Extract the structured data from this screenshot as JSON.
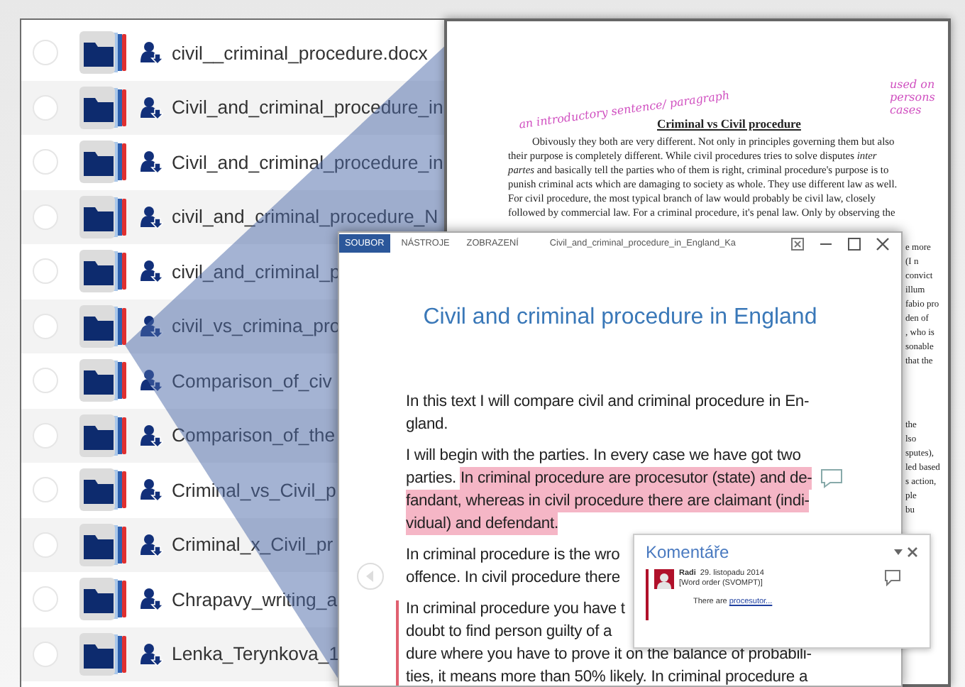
{
  "file_list": {
    "rows": [
      {
        "name": "civil__criminal_procedure.docx",
        "selected": false
      },
      {
        "name": "Civil_and_criminal_procedure_in",
        "selected": false
      },
      {
        "name": "Civil_and_criminal_procedure_in",
        "selected": false
      },
      {
        "name": "civil_and_criminal_procedure_N",
        "selected": false
      },
      {
        "name": "civil_and_criminal_p",
        "selected": false
      },
      {
        "name": "civil_vs_crimina_pro",
        "selected": false
      },
      {
        "name": "Comparison_of_civ",
        "selected": false
      },
      {
        "name": "Comparison_of_the",
        "selected": false
      },
      {
        "name": "Criminal_vs_Civil_p",
        "selected": false
      },
      {
        "name": "Criminal_x_Civil_pr",
        "selected": false
      },
      {
        "name": "Chrapavy_writing_a",
        "selected": false
      },
      {
        "name": "Lenka_Terynkova_1",
        "selected": false
      }
    ]
  },
  "back_document": {
    "annotations": [
      "an introductory sentence/ paragraph",
      "used on persons cases"
    ],
    "title": "Criminal vs Civil procedure",
    "lines": [
      "Obivously they both are very different. Not only in principles governing them but also",
      "their purpose is completely different. While civil procedures tries to solve disputes *inter*",
      "*partes* and basically tell the parties who of them is right, criminal procedure's purpose is to",
      "punish criminal acts which are damaging to society as whole. They use different law as well.",
      "For civil procedure, the most typical branch of law would probably be civil law, closely",
      "followed by commercial law. For a criminal procedure, it's penal law. Only by observing the"
    ],
    "side_fragments": [
      [
        "e more",
        "(I n",
        "convict",
        "illum",
        "fabio pro",
        "den of",
        ", who is",
        "sonable",
        "that the"
      ],
      [
        "the",
        "lso",
        "sputes),",
        "led based",
        "s action,",
        "ple",
        "bu"
      ]
    ]
  },
  "front_document": {
    "tabs": [
      {
        "label": "SOUBOR",
        "selected": true
      },
      {
        "label": "NÁSTROJE",
        "selected": false
      },
      {
        "label": "ZOBRAZENÍ",
        "selected": false
      }
    ],
    "file_title": "Civil_and_criminal_procedure_in_England_Ka",
    "heading": "Civil and criminal procedure in England",
    "paragraphs": [
      {
        "changed": false,
        "has_comment": false,
        "lines": [
          [
            {
              "text": "In this text I will compare civil and criminal procedure in En-",
              "highlighted": false
            }
          ],
          [
            {
              "text": "gland.",
              "highlighted": false
            }
          ]
        ]
      },
      {
        "changed": false,
        "has_comment": true,
        "lines": [
          [
            {
              "text": "I will begin with the parties. In every case we have got two",
              "highlighted": false
            }
          ],
          [
            {
              "text": "parties. ",
              "highlighted": false
            },
            {
              "text": "In criminal procedure are procesutor (state) and de-",
              "highlighted": true
            }
          ],
          [
            {
              "text": "fandant, whereas in civil procedure there are claimant (indi-",
              "highlighted": true
            }
          ],
          [
            {
              "text": "vidual) and defendant.",
              "highlighted": true
            }
          ]
        ]
      },
      {
        "changed": false,
        "has_comment": false,
        "lines": [
          [
            {
              "text": "In criminal procedure is the wro",
              "highlighted": false
            }
          ],
          [
            {
              "text": "offence. In civil procedure there",
              "highlighted": false
            }
          ]
        ]
      },
      {
        "changed": true,
        "has_comment": false,
        "lines": [
          [
            {
              "text": "In criminal procedure you have t",
              "highlighted": false
            }
          ],
          [
            {
              "text": "doubt to find person guilty of a",
              "highlighted": false
            }
          ],
          [
            {
              "text": "dure where you have to prove it on the balance of probabili-",
              "highlighted": false
            }
          ],
          [
            {
              "text": "ties, it means more than 50% likely. In criminal procedure a",
              "highlighted": false
            }
          ]
        ]
      }
    ]
  },
  "comments_pane": {
    "title": "Komentáře",
    "comments": [
      {
        "author": "Radi",
        "date": "29. listopadu 2014",
        "tag": "[Word order (SVOMPT)]",
        "text": "There are ",
        "link": "procesutor..."
      }
    ]
  }
}
